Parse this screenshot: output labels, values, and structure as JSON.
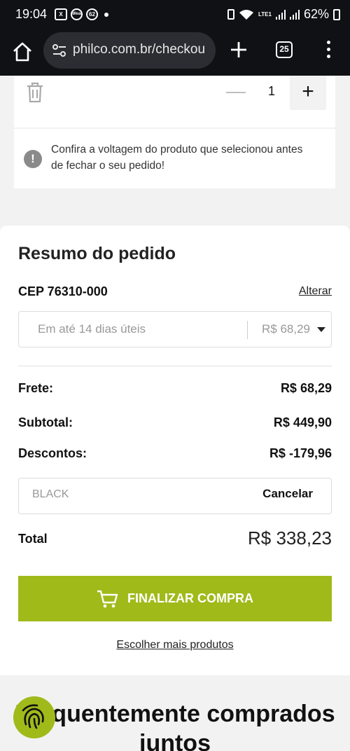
{
  "status_bar": {
    "time": "19:04",
    "notif_icon_1": "X",
    "notif_icon_2": "Wear",
    "notif_badge": "62",
    "network_label": "LTE1",
    "battery": "62%"
  },
  "browser": {
    "url": "philco.com.br/checkou",
    "tab_count": "25"
  },
  "cart_item": {
    "quantity": "1",
    "minus_label": "—",
    "plus_label": "+"
  },
  "notice": {
    "icon_text": "!",
    "text": "Confira a voltagem do produto que selecionou antes de fechar o seu pedido!"
  },
  "summary": {
    "title": "Resumo do pedido",
    "cep_label": "CEP 76310-000",
    "alter_link": "Alterar",
    "shipping_option": "Em até 14 dias úteis",
    "shipping_price": "R$ 68,29",
    "rows": [
      {
        "label": "Frete:",
        "value": "R$ 68,29"
      },
      {
        "label": "Subtotal:",
        "value": "R$ 449,90"
      },
      {
        "label": "Descontos:",
        "value": "R$ -179,96"
      }
    ],
    "coupon_code": "BLACK",
    "coupon_cancel": "Cancelar",
    "total_label": "Total",
    "total_value": "R$ 338,23",
    "checkout_button": "FINALIZAR COMPRA",
    "more_products_link": "Escolher mais produtos"
  },
  "related": {
    "title": "Frequentemente comprados juntos"
  },
  "colors": {
    "accent": "#a0ba1a",
    "toolbar_bg": "#101114",
    "page_bg": "#f2f2f2"
  },
  "icons": [
    "home-icon",
    "tune-icon",
    "plus-icon",
    "tabs-icon",
    "more-vert-icon",
    "trash-icon",
    "alert-icon",
    "caret-down-icon",
    "cart-icon",
    "fingerprint-icon"
  ]
}
